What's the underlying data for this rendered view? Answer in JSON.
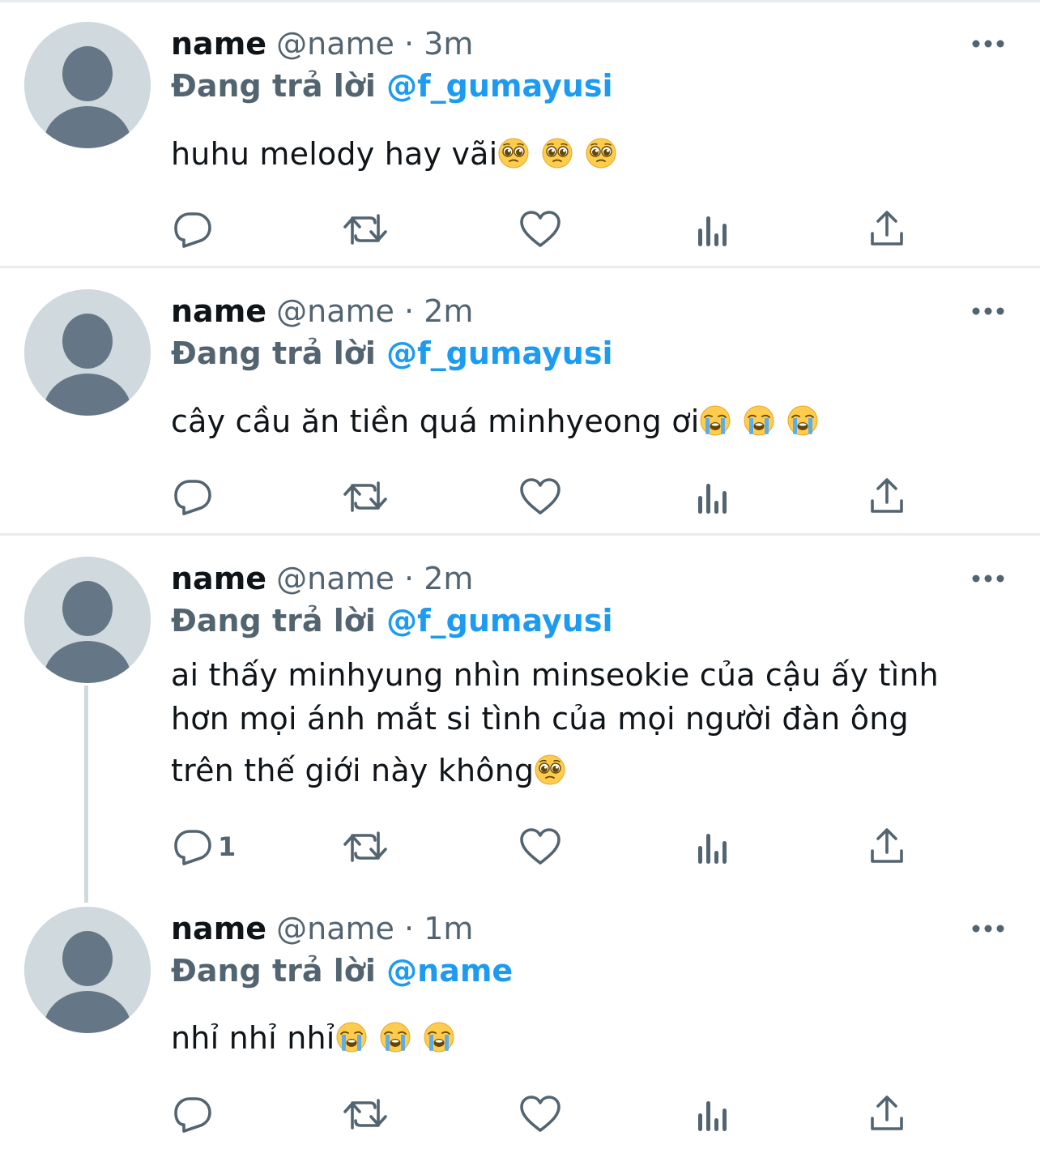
{
  "tweets": [
    {
      "name": "name",
      "handle": "@name",
      "dot": "·",
      "time": "3m",
      "replying_prefix": "Đang trả lời",
      "replying_to": "@f_gumayusi",
      "text": "huhu melody hay vãi",
      "emojis": [
        "pleading-face",
        "pleading-face",
        "pleading-face"
      ],
      "reply_count": "",
      "more_icon": "more-icon"
    },
    {
      "name": "name",
      "handle": "@name",
      "dot": "·",
      "time": "2m",
      "replying_prefix": "Đang trả lời",
      "replying_to": "@f_gumayusi",
      "text": "cây cầu ăn tiền quá minhyeong ơi",
      "emojis": [
        "loudly-crying-face",
        "loudly-crying-face",
        "loudly-crying-face"
      ],
      "reply_count": "",
      "more_icon": "more-icon"
    },
    {
      "name": "name",
      "handle": "@name",
      "dot": "·",
      "time": "2m",
      "replying_prefix": "Đang trả lời",
      "replying_to": "@f_gumayusi",
      "text_lines": [
        "ai thấy minhyung nhìn minseokie của cậu ấy tình",
        "hơn mọi ánh mắt si tình của mọi người đàn ông",
        "trên thế giới này không"
      ],
      "emojis": [
        "pleading-face"
      ],
      "reply_count": "1",
      "more_icon": "more-icon"
    },
    {
      "name": "name",
      "handle": "@name",
      "dot": "·",
      "time": "1m",
      "replying_prefix": "Đang trả lời",
      "replying_to": "@name",
      "text": "nhỉ nhỉ nhỉ",
      "emojis": [
        "loudly-crying-face",
        "loudly-crying-face",
        "loudly-crying-face"
      ],
      "reply_count": "",
      "more_icon": "more-icon"
    }
  ],
  "action_icons": [
    "reply-icon",
    "retweet-icon",
    "like-icon",
    "analytics-icon",
    "share-icon"
  ],
  "colors": {
    "text_primary": "#0f1419",
    "text_secondary": "#536471",
    "mention": "#1d9bf0",
    "divider": "#e6ecf0",
    "avatar_bg": "#cfd9de",
    "avatar_fg": "#657786"
  }
}
